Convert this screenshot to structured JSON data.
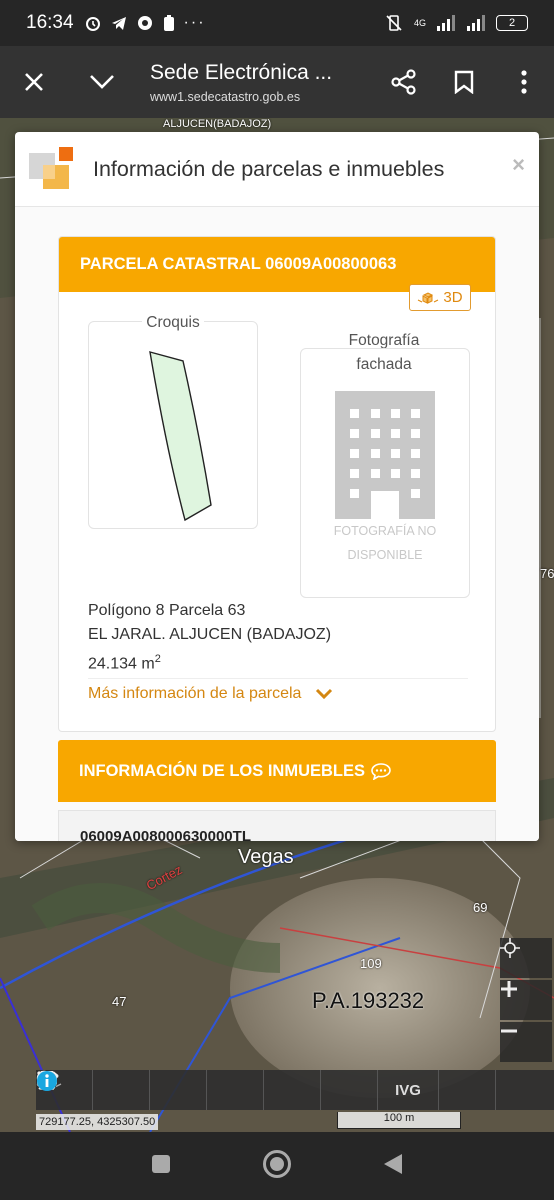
{
  "status_bar": {
    "time": "16:34",
    "network": "4G",
    "battery": "2"
  },
  "browser": {
    "title": "Sede Electrónica ...",
    "url": "www1.sedecatastro.gob.es"
  },
  "map": {
    "place_label": "ALJUCEN(BADAJOZ)",
    "labels": [
      "Vegas",
      "Cortez",
      "69",
      "109",
      "47",
      "P.A.193232"
    ],
    "edge_number": "76",
    "coordinates": "729177.25, 4325307.50",
    "scale": "100 m",
    "tools": [
      "chevron-right-icon",
      "search-icon",
      "layers-icon",
      "measure-icon",
      "print-icon",
      "parking-icon",
      "ivg-label",
      "3d-cubes-icon",
      "info-icon"
    ],
    "ivg_label": "IVG"
  },
  "modal": {
    "title": "Información de parcelas e inmuebles",
    "close": "×",
    "parcel_header": "PARCELA CATASTRAL 06009A00800063",
    "btn_3d": "3D",
    "croquis_label": "Croquis",
    "foto_label_1": "Fotografía",
    "foto_label_2": "fachada",
    "foto_unavailable_1": "FOTOGRAFÍA NO",
    "foto_unavailable_2": "DISPONIBLE",
    "parcel_line1": "Polígono 8 Parcela 63",
    "parcel_line2": "EL JARAL. ALJUCEN (BADAJOZ)",
    "parcel_area": "24.134 m",
    "parcel_area_sup": "2",
    "more_info": "Más información de la parcela",
    "inmuebles_header": "INFORMACIÓN DE LOS INMUEBLES",
    "inmueble_ref": "06009A008000630000TL"
  },
  "colors": {
    "accent": "#f8a700",
    "link": "#d48712",
    "parcel_fill": "#dff5df"
  }
}
